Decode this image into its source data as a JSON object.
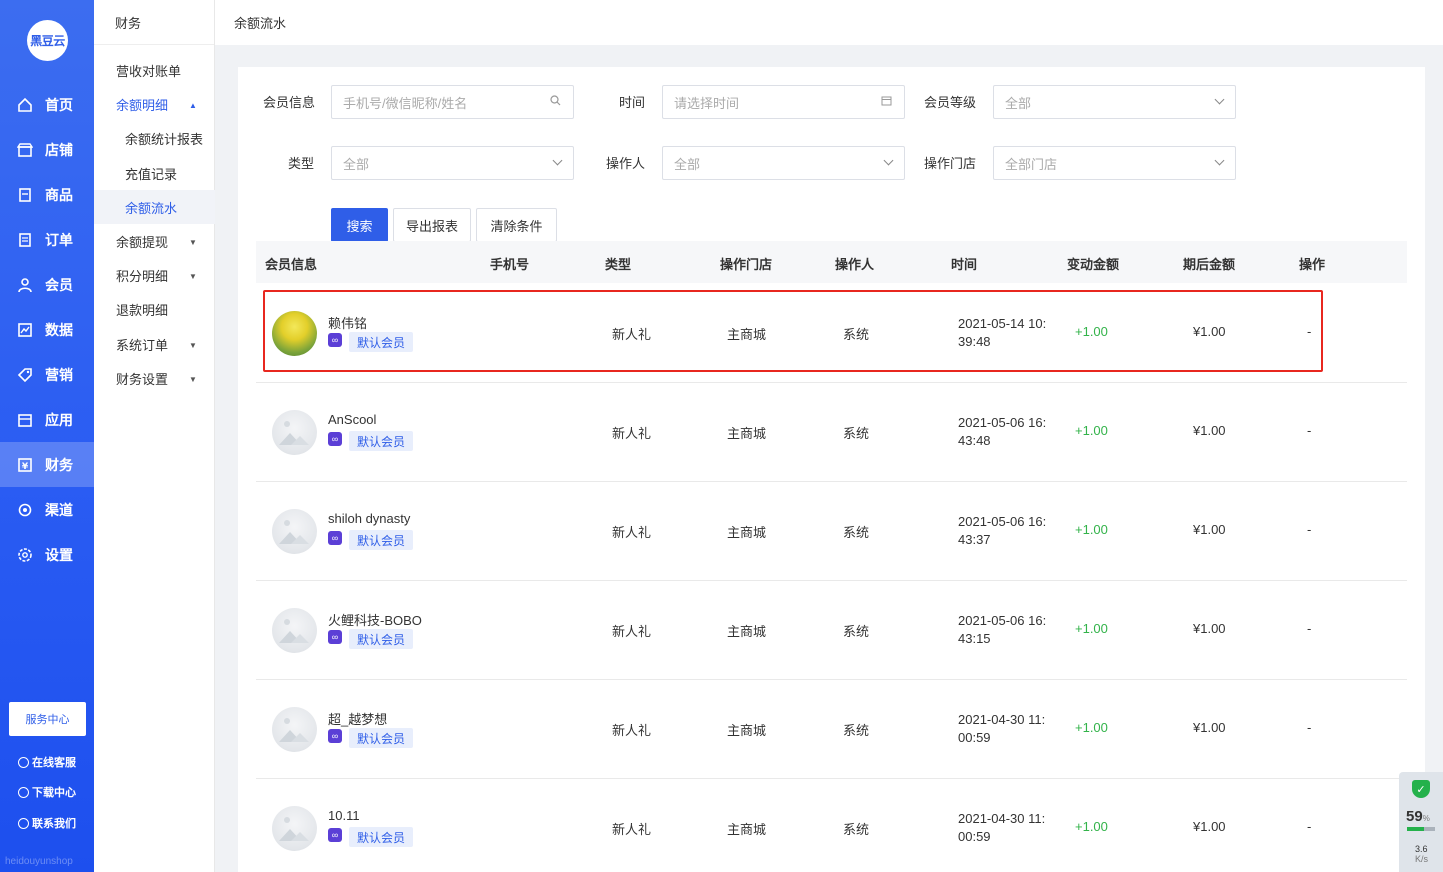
{
  "nav": {
    "logo": "黑豆云",
    "items": [
      {
        "label": "首页",
        "icon": "home-icon"
      },
      {
        "label": "店铺",
        "icon": "store-icon"
      },
      {
        "label": "商品",
        "icon": "goods-icon"
      },
      {
        "label": "订单",
        "icon": "order-icon"
      },
      {
        "label": "会员",
        "icon": "user-icon"
      },
      {
        "label": "数据",
        "icon": "chart-icon"
      },
      {
        "label": "营销",
        "icon": "tag-icon"
      },
      {
        "label": "应用",
        "icon": "app-icon"
      },
      {
        "label": "财务",
        "icon": "finance-icon"
      },
      {
        "label": "渠道",
        "icon": "channel-icon"
      },
      {
        "label": "设置",
        "icon": "gear-icon"
      }
    ],
    "service_center": "服务中心",
    "links": [
      "在线客服",
      "下载中心",
      "联系我们"
    ],
    "footer": "heidouyunshop"
  },
  "subnav": {
    "title": "财务",
    "items": [
      "营收对账单",
      "余额明细",
      "余额统计报表",
      "充值记录",
      "余额流水",
      "余额提现",
      "积分明细",
      "退款明细",
      "系统订单",
      "财务设置"
    ]
  },
  "breadcrumb": "余额流水",
  "filters": {
    "member_label": "会员信息",
    "member_placeholder": "手机号/微信昵称/姓名",
    "time_label": "时间",
    "time_placeholder": "请选择时间",
    "level_label": "会员等级",
    "level_value": "全部",
    "type_label": "类型",
    "type_value": "全部",
    "operator_label": "操作人",
    "operator_value": "全部",
    "store_label": "操作门店",
    "store_value": "全部门店"
  },
  "buttons": {
    "search": "搜索",
    "export": "导出报表",
    "clear": "清除条件"
  },
  "table": {
    "columns": [
      "会员信息",
      "手机号",
      "类型",
      "操作门店",
      "操作人",
      "时间",
      "变动金额",
      "期后金额",
      "操作"
    ],
    "rows": [
      {
        "name": "赖伟铭",
        "tag": "默认会员",
        "phone": "",
        "type": "新人礼",
        "store": "主商城",
        "operator": "系统",
        "time": "2021-05-14 10:39:48",
        "change": "+1.00",
        "after": "¥1.00",
        "action": "-"
      },
      {
        "name": "AnScool",
        "tag": "默认会员",
        "phone": "",
        "type": "新人礼",
        "store": "主商城",
        "operator": "系统",
        "time": "2021-05-06 16:43:48",
        "change": "+1.00",
        "after": "¥1.00",
        "action": "-"
      },
      {
        "name": "shiloh dynasty",
        "tag": "默认会员",
        "phone": "",
        "type": "新人礼",
        "store": "主商城",
        "operator": "系统",
        "time": "2021-05-06 16:43:37",
        "change": "+1.00",
        "after": "¥1.00",
        "action": "-"
      },
      {
        "name": "火鲤科技-BOBO",
        "tag": "默认会员",
        "phone": "",
        "type": "新人礼",
        "store": "主商城",
        "operator": "系统",
        "time": "2021-05-06 16:43:15",
        "change": "+1.00",
        "after": "¥1.00",
        "action": "-"
      },
      {
        "name": "超_越梦想",
        "tag": "默认会员",
        "phone": "",
        "type": "新人礼",
        "store": "主商城",
        "operator": "系统",
        "time": "2021-04-30 11:00:59",
        "change": "+1.00",
        "after": "¥1.00",
        "action": "-"
      },
      {
        "name": "10.11",
        "tag": "默认会员",
        "phone": "",
        "type": "新人礼",
        "store": "主商城",
        "operator": "系统",
        "time": "2021-04-30 11:00:59",
        "change": "+1.00",
        "after": "¥1.00",
        "action": "-"
      }
    ]
  },
  "colors": {
    "accent": "#2f5ee8",
    "positive": "#33b34a",
    "highlight": "#e8271f"
  },
  "widget": {
    "percent": "59",
    "percent_unit": "%",
    "speed": "3.6",
    "speed_unit": "K/s",
    "level": 0.59
  }
}
